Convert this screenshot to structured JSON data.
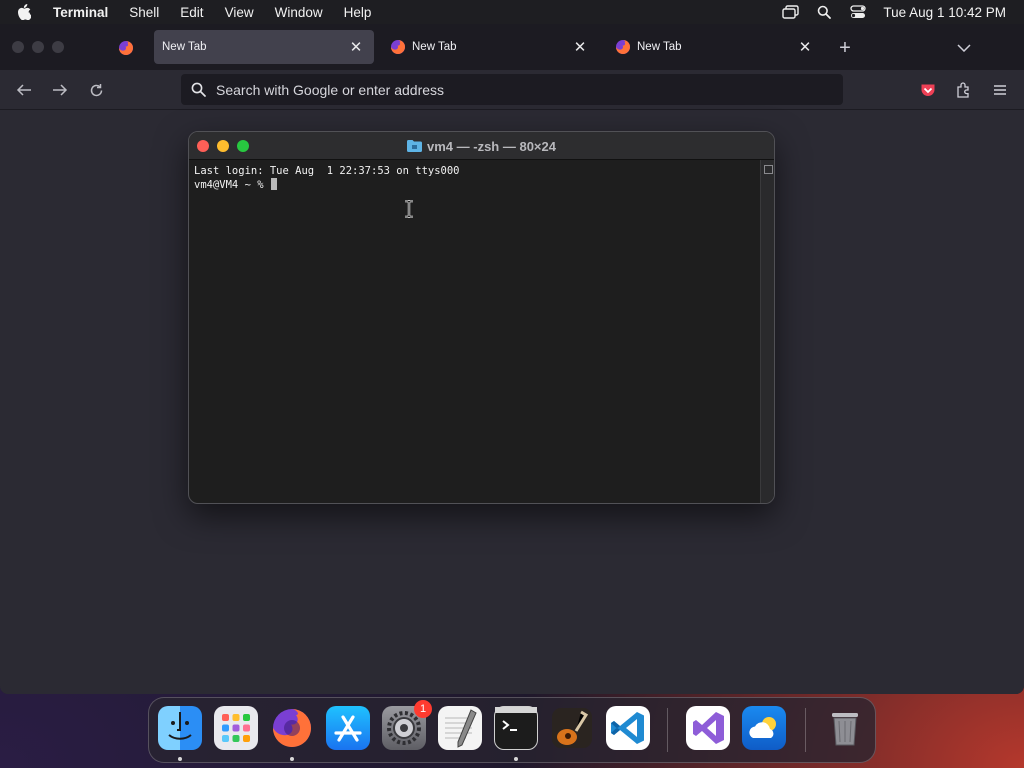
{
  "menubar": {
    "app_name": "Terminal",
    "items": [
      "Shell",
      "Edit",
      "View",
      "Window",
      "Help"
    ],
    "clock": "Tue Aug 1  10:42 PM"
  },
  "browser": {
    "tabs": [
      {
        "title": "New Tab",
        "active": true
      },
      {
        "title": "New Tab",
        "active": false
      },
      {
        "title": "New Tab",
        "active": false
      }
    ],
    "url_placeholder": "Search with Google or enter address"
  },
  "terminal": {
    "title": "vm4 — -zsh — 80×24",
    "lines": [
      "Last login: Tue Aug  1 22:37:53 on ttys000",
      "vm4@VM4 ~ % "
    ]
  },
  "dock": {
    "apps": [
      {
        "name": "Finder",
        "icon": "finder-icon",
        "running": true
      },
      {
        "name": "Launchpad",
        "icon": "launchpad-icon",
        "running": false
      },
      {
        "name": "Firefox",
        "icon": "firefox-icon",
        "running": true
      },
      {
        "name": "App Store",
        "icon": "app-store-icon",
        "running": false
      },
      {
        "name": "System Settings",
        "icon": "system-settings-icon",
        "running": false,
        "badge": "1"
      },
      {
        "name": "TextEdit",
        "icon": "textedit-icon",
        "running": false
      },
      {
        "name": "Terminal",
        "icon": "terminal-icon",
        "running": true
      },
      {
        "name": "GarageBand",
        "icon": "garageband-icon",
        "running": false
      },
      {
        "name": "Visual Studio Code",
        "icon": "vscode-icon",
        "running": false
      },
      {
        "name": "Visual Studio",
        "icon": "visual-studio-icon",
        "running": false
      },
      {
        "name": "Weather",
        "icon": "weather-icon",
        "running": false
      },
      {
        "name": "Trash",
        "icon": "trash-icon",
        "running": false
      }
    ]
  },
  "colors": {
    "accent_red": "#fe5f57",
    "accent_yellow": "#febc2e",
    "accent_green": "#28c840",
    "browser_bg": "#2b2a33"
  }
}
